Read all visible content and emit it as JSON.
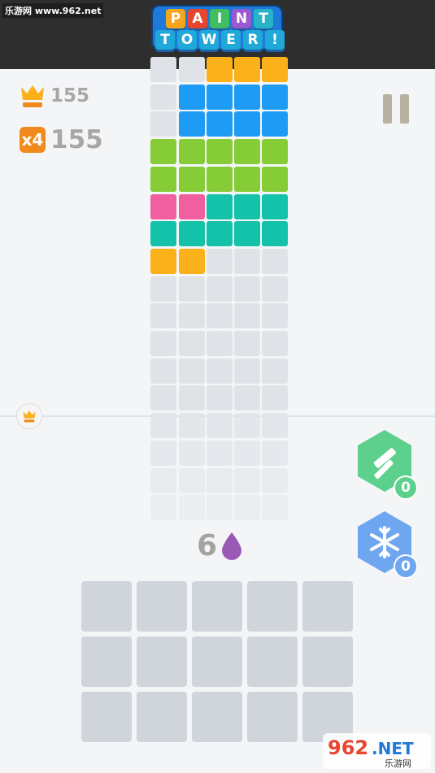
{
  "watermark_top": "乐游网 www.962.net",
  "logo": {
    "row1": [
      {
        "ch": "P",
        "color": "#f4a51c"
      },
      {
        "ch": "A",
        "color": "#e8452f"
      },
      {
        "ch": "I",
        "color": "#3fbf62"
      },
      {
        "ch": "N",
        "color": "#9b59d0"
      },
      {
        "ch": "T",
        "color": "#27b3c8"
      }
    ],
    "row2": [
      {
        "ch": "T",
        "color": "#1fa8d8"
      },
      {
        "ch": "O",
        "color": "#1fa8d8"
      },
      {
        "ch": "W",
        "color": "#1fa8d8"
      },
      {
        "ch": "E",
        "color": "#1fa8d8"
      },
      {
        "ch": "R",
        "color": "#1fa8d8"
      },
      {
        "ch": "!",
        "color": "#1fa8d8"
      }
    ]
  },
  "hud": {
    "best_score": "155",
    "multiplier": "x4",
    "score": "155"
  },
  "tower": {
    "colors": {
      "O": "#fbb11a",
      "B": "#1e9bf5",
      "G": "#86cc36",
      "P": "#f25fa0",
      "T": "#14c2a9",
      "E": "#dfe3e8"
    },
    "rows": [
      "EEOOO",
      "EBBBB",
      "EBBBB",
      "GGGGG",
      "GGGGG",
      "PPTTT",
      "TTTTT",
      "OOEEE",
      "EEEEE",
      "EEEEE",
      "EEEEE",
      "EEEEE",
      "EEEEE",
      "EEEEE",
      "EEEEE",
      "EEEEE",
      "EEEEE"
    ]
  },
  "powerups": {
    "hammer": {
      "icon": "hammer-icon",
      "count": "0",
      "color": "#5cd08c"
    },
    "freeze": {
      "icon": "snowflake-icon",
      "count": "0",
      "color": "#6ea6f0"
    }
  },
  "drops": {
    "value": "6",
    "icon": "paint-drop-icon",
    "color": "#9b59b6"
  },
  "placement_grid": {
    "rows": 3,
    "cols": 5
  },
  "watermark_bottom": {
    "main": "962.NET",
    "sub": "乐游网"
  }
}
